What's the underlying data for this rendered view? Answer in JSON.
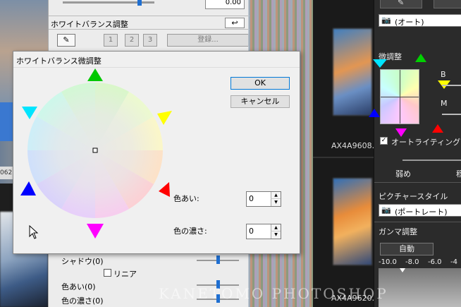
{
  "background_panel": {
    "value_field": "0.00",
    "wb_title": "ホワイトバランス調整",
    "preset_buttons": [
      "1",
      "2",
      "3"
    ],
    "register_button": "登録...",
    "shadow_label": "シャドウ(0)",
    "linear_label": "リニア",
    "hue_label": "色あい(0)",
    "saturation_label": "色の濃さ(0)"
  },
  "left_label": "062",
  "thumbnails": {
    "label1": "AX4A9608.",
    "label2": "AX4A9620."
  },
  "right_panel": {
    "auto_select": "(オート)",
    "fine_adjust_label": "微調整",
    "b_label": "B",
    "m_label": "M",
    "auto_lighting_label": "オートライティングオプ",
    "weak_label": "弱め",
    "strong_label_partial": "程",
    "picture_style_label": "ピクチャースタイル",
    "picture_style_value": "(ポートレート)",
    "gamma_label": "ガンマ調整",
    "gamma_auto_button": "自動",
    "gamma_scale": [
      "-10.0",
      "-8.0",
      "-6.0",
      "-4"
    ]
  },
  "dialog": {
    "title": "ホワイトバランス微調整",
    "ok_button": "OK",
    "cancel_button": "キャンセル",
    "hue_label": "色あい:",
    "hue_value": "0",
    "saturation_label": "色の濃さ:",
    "saturation_value": "0",
    "marker_colors": {
      "green": "#00c800",
      "yellow": "#ffff00",
      "red": "#ff0000",
      "magenta": "#ff00ff",
      "blue": "#0000ff",
      "cyan": "#00e5ff"
    }
  },
  "watermark": "KANETOMO PHOTOSHOP"
}
